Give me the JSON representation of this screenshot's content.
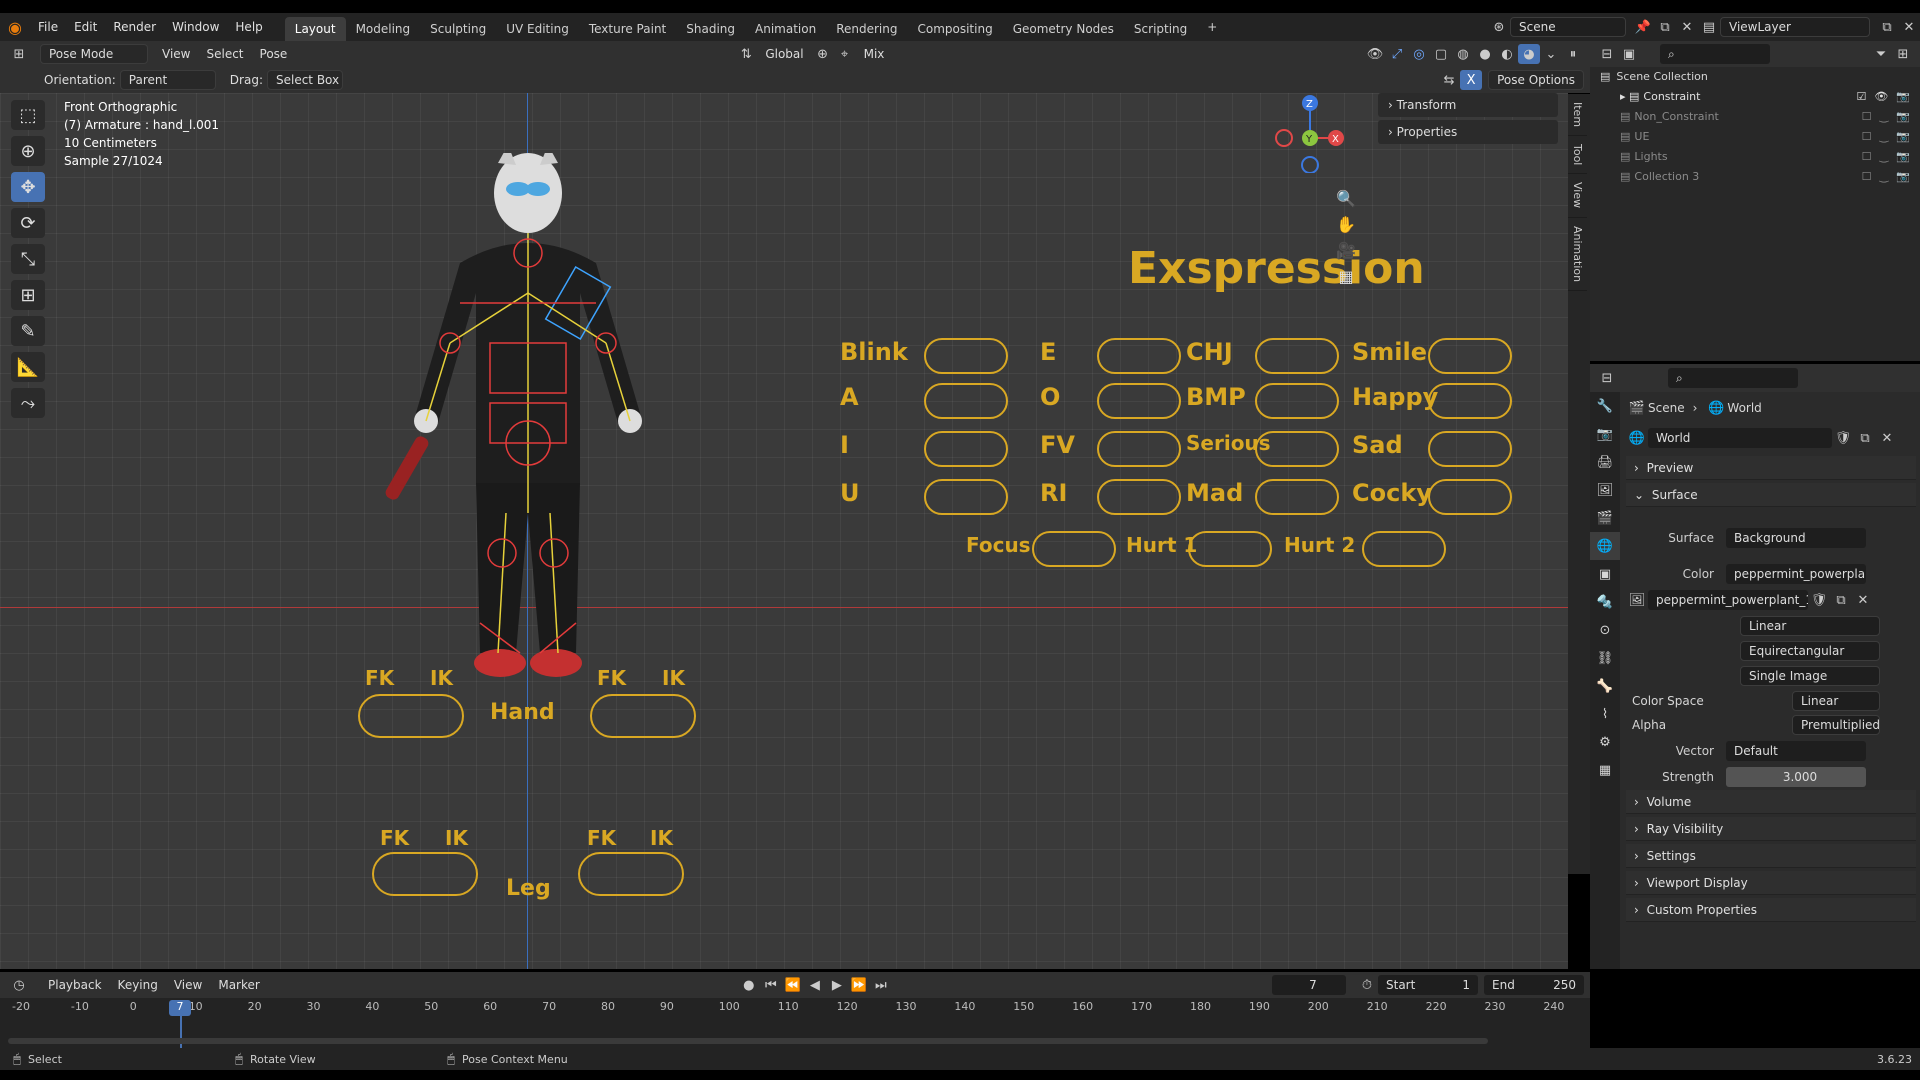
{
  "menubar": {
    "items": [
      "File",
      "Edit",
      "Render",
      "Window",
      "Help"
    ],
    "workspaces": [
      "Layout",
      "Modeling",
      "Sculpting",
      "UV Editing",
      "Texture Paint",
      "Shading",
      "Animation",
      "Rendering",
      "Compositing",
      "Geometry Nodes",
      "Scripting"
    ],
    "add_tab": "+",
    "scene": "Scene",
    "viewlayer": "ViewLayer"
  },
  "viewport_header": {
    "mode": "Pose Mode",
    "menus": [
      "View",
      "Select",
      "Pose"
    ],
    "transform_orientation": "Global",
    "pivot": "Mix"
  },
  "tool_settings": {
    "orientation_label": "Orientation:",
    "orientation": "Parent",
    "drag_label": "Drag:",
    "drag": "Select Box",
    "pose_options": "Pose Options",
    "x_mirror": "X"
  },
  "viewport_info": [
    "Front Orthographic",
    "(7) Armature : hand_l.001",
    "10 Centimeters",
    "Sample 27/1024"
  ],
  "npanel": {
    "rows": [
      "Transform",
      "Properties"
    ],
    "tabs": [
      "Item",
      "Tool",
      "View",
      "Animation"
    ]
  },
  "gizmo": {
    "z": "Z",
    "y": "Y",
    "x": "X"
  },
  "rig_ui": {
    "title": "Exspression",
    "col1": [
      "Blink",
      "A",
      "I",
      "U"
    ],
    "col2": [
      "E",
      "O",
      "FV",
      "RI"
    ],
    "col3": [
      "CHJ",
      "BMP",
      "Serious",
      "Mad"
    ],
    "col4": [
      "Smile",
      "Happy",
      "Sad",
      "Cocky"
    ],
    "row5": [
      "Focus",
      "Hurt 1",
      "Hurt 2"
    ],
    "fk": "FK",
    "ik": "IK",
    "hand": "Hand",
    "leg": "Leg"
  },
  "outliner": {
    "root": "Scene Collection",
    "items": [
      "Constraint",
      "Non_Constraint",
      "UE",
      "Lights",
      "Collection 3"
    ]
  },
  "properties": {
    "breadcrumb_scene": "Scene",
    "breadcrumb_world": "World",
    "world_name": "World",
    "sections_top": [
      "Preview",
      "Surface"
    ],
    "surface_label": "Surface",
    "surface_value": "Background",
    "color_label": "Color",
    "color_value": "peppermint_powerpla...",
    "image_name": "peppermint_powerplant_1...",
    "interp": "Linear",
    "projection": "Equirectangular",
    "source": "Single Image",
    "colorspace_label": "Color Space",
    "colorspace": "Linear",
    "alpha_label": "Alpha",
    "alpha": "Premultiplied",
    "vector_label": "Vector",
    "vector": "Default",
    "strength_label": "Strength",
    "strength": "3.000",
    "sections_bottom": [
      "Volume",
      "Ray Visibility",
      "Settings",
      "Viewport Display",
      "Custom Properties"
    ]
  },
  "timeline": {
    "menus": [
      "Playback",
      "Keying",
      "View",
      "Marker"
    ],
    "current": "7",
    "start_label": "Start",
    "start": "1",
    "end_label": "End",
    "end": "250",
    "ticks": [
      "-20",
      "-10",
      "0",
      "10",
      "20",
      "30",
      "40",
      "50",
      "60",
      "70",
      "80",
      "90",
      "100",
      "110",
      "120",
      "130",
      "140",
      "150",
      "160",
      "170",
      "180",
      "190",
      "200",
      "210",
      "220",
      "230",
      "240"
    ],
    "playhead": "7"
  },
  "statusbar": {
    "select": "Select",
    "rotate": "Rotate View",
    "context": "Pose Context Menu",
    "version": "3.6.23"
  },
  "colors": {
    "accent": "#4772b3",
    "rig_gold": "#d9a823",
    "bone_red": "#e33b3b",
    "bone_yellow": "#e6d13a"
  }
}
